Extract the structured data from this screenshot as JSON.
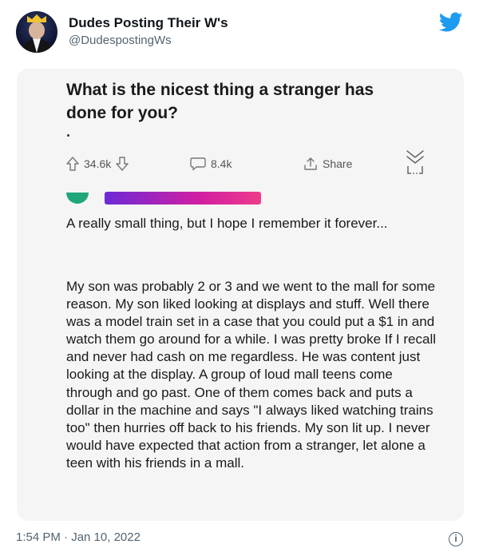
{
  "tweet": {
    "display_name": "Dudes Posting Their W's",
    "handle": "@DudespostingWs",
    "timestamp": "1:54 PM · Jan 10, 2022",
    "info_icon": "info-icon",
    "brand_color": "#1d9bf0"
  },
  "embedded_post": {
    "question": "What is the nicest thing a stranger has done for you?",
    "upvotes": "34.6k",
    "comments": "8.4k",
    "share_label": "Share",
    "comment_title": "A really small thing, but I hope I remember it forever...",
    "comment_body": "My son was probably 2 or 3 and we went to the mall for some reason. My son liked looking at displays and stuff. Well there was a model train set in a case that you could put a $1 in and watch them go around for a while. I was pretty broke If I recall and never had cash on me regardless. He was content just looking at the display. A group of loud mall teens come through and go past. One of them comes back and puts a dollar in the machine and says \"I always liked watching trains too\" then hurries off back to his friends. My son lit up. I never would have expected that action from a stranger, let alone a teen with his friends in a mall."
  }
}
